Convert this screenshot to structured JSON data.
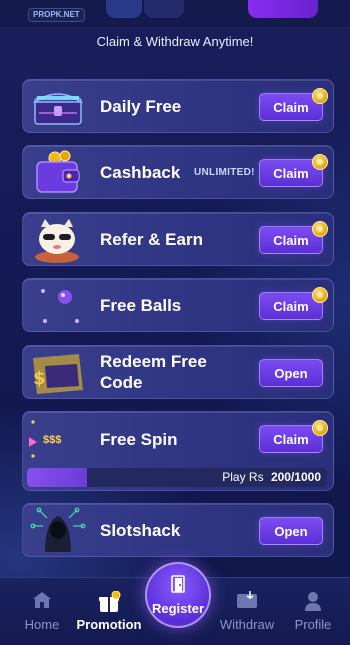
{
  "header": {
    "brand": "PROPK.NET",
    "subtitle": "Claim & Withdraw Anytime!"
  },
  "cards": [
    {
      "title": "Daily Free",
      "action": "Claim",
      "icon": "treasure-chest-icon"
    },
    {
      "title": "Cashback",
      "tag": "UNLIMITED!",
      "action": "Claim",
      "icon": "wallet-icon"
    },
    {
      "title": "Refer & Earn",
      "action": "Claim",
      "icon": "lucky-cat-icon"
    },
    {
      "title": "Free Balls",
      "action": "Claim",
      "icon": "balls-icon"
    },
    {
      "title": "Redeem Free Code",
      "action": "Open",
      "icon": "ticket-icon"
    },
    {
      "title": "Free Spin",
      "action": "Claim",
      "icon": "spin-arrow-icon",
      "spin_label": "$$$",
      "progress": {
        "prefix": "Play Rs",
        "current": 200,
        "target": 1000,
        "text": "200/1000"
      }
    },
    {
      "title": "Slotshack",
      "action": "Open",
      "icon": "hacker-icon"
    }
  ],
  "nav": {
    "home": "Home",
    "promotion": "Promotion",
    "register": "Register",
    "withdraw": "Withdraw",
    "profile": "Profile"
  },
  "colors": {
    "accent": "#6a3ce0",
    "coin": "#f2b90f",
    "background": "#141a55"
  }
}
